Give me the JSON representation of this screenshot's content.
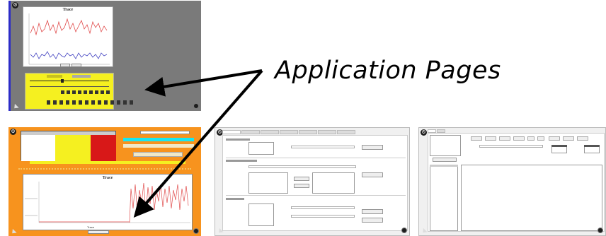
{
  "callout": {
    "text": "Application Pages"
  },
  "thumb1": {
    "chart_title": "Trace",
    "button_labels": [
      "Pause",
      "Pro"
    ]
  },
  "thumb2": {
    "plot_title": "Trace",
    "plot_xlabel": "Trace"
  },
  "colors": {
    "thumb1_bg": "#7a7a7a",
    "thumb2_bg": "#f7931e",
    "yellow_panel": "#f5f020",
    "trace_red": "#e04a4a",
    "trace_blue": "#4040c0",
    "cyan_field": "#19e6f0"
  },
  "icons": {
    "top_left": "gear-icon",
    "bottom_right": "dot-icon",
    "bottom_left": "resize-icon",
    "arrow": "arrow-icon"
  }
}
